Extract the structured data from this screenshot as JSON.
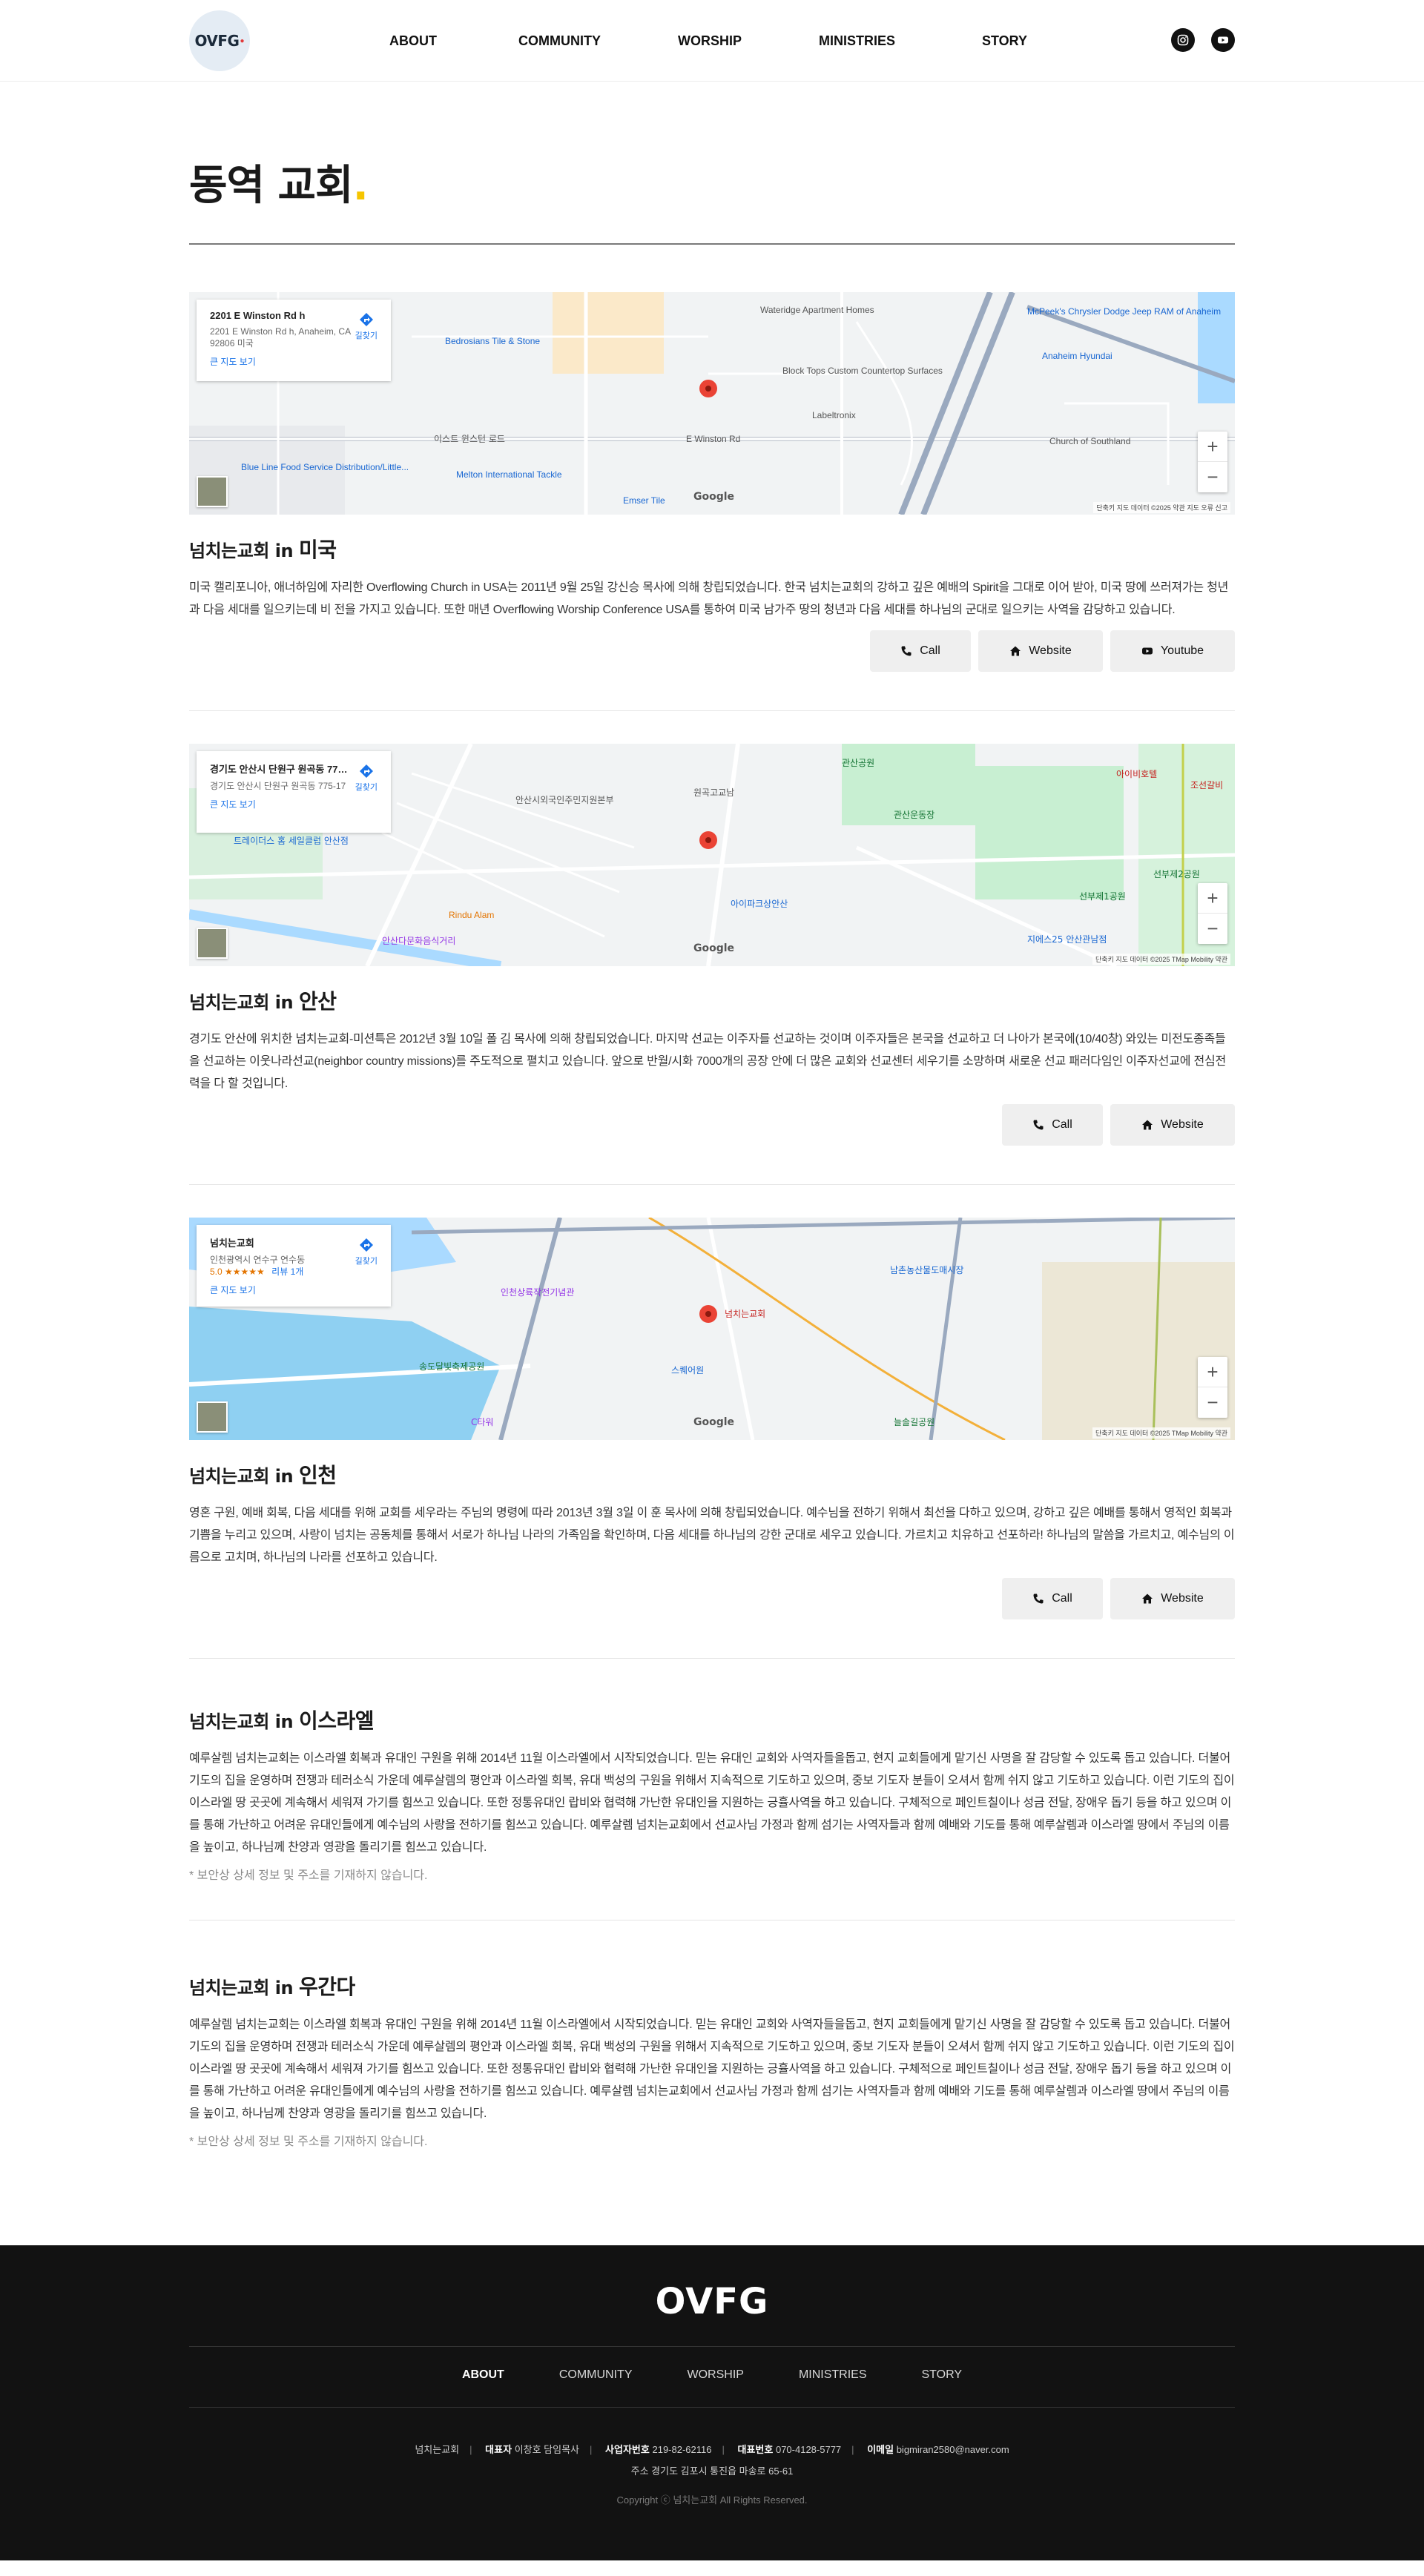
{
  "header": {
    "logo_text": "OVFG",
    "nav": [
      "ABOUT",
      "COMMUNITY",
      "WORSHIP",
      "MINISTRIES",
      "STORY"
    ],
    "social": [
      "instagram-icon",
      "youtube-icon"
    ]
  },
  "page": {
    "title": "동역 교회",
    "title_dot": "."
  },
  "churches": [
    {
      "prefix": "넘치는교회 in",
      "location": "미국",
      "map": {
        "place": "2201 E Winston Rd h",
        "address": "2201 E Winston Rd h, Anaheim, CA 92806 미국",
        "larger_map": "큰 지도 보기",
        "directions": "길찾기",
        "google": "Google",
        "attribution": "단축키   지도 데이터 ©2025   약관   지도 오류 신고",
        "labels": [
          "Wateridge Apartment Homes",
          "Bedrosians Tile & Stone",
          "Block Tops Custom Countertop Surfaces",
          "Labeltronix",
          "McPeek's Chrysler Dodge Jeep RAM of Anaheim",
          "Anaheim Hyundai",
          "Church of Southland",
          "이스트 윈스턴 로드",
          "E Winston Rd",
          "Blue Line Food Service Distribution/Little...",
          "Melton International Tackle",
          "Emser Tile"
        ]
      },
      "description": "미국 캘리포니아, 애너하임에 자리한 Overflowing Church in USA는 2011년 9월 25일 강신승 목사에 의해 창립되었습니다. 한국 넘치는교회의 강하고 깊은 예배의 Spirit을 그대로 이어 받아, 미국 땅에 쓰러져가는 청년과 다음 세대를 일으키는데 비 전을 가지고 있습니다. 또한 매년 Overflowing Worship Conference USA를 통하여 미국 남가주 땅의 청년과 다음 세대를 하나님의 군대로 일으키는 사역을 감당하고 있습니다.",
      "buttons": [
        "Call",
        "Website",
        "Youtube"
      ]
    },
    {
      "prefix": "넘치는교회 in",
      "location": "안산",
      "map": {
        "place": "경기도 안산시 단원구 원곡동 775-17",
        "address": "경기도 안산시 단원구 원곡동 775-17",
        "larger_map": "큰 지도 보기",
        "directions": "길찾기",
        "google": "Google",
        "attribution": "단축키   지도 데이터 ©2025 TMap Mobility   약관",
        "labels": [
          "관산공원",
          "관산운동장",
          "아이비호텔",
          "조선갈비",
          "선부제2공원",
          "선부제1공원",
          "트레이더스 홈 세일클럽 안산점",
          "Rindu Alam",
          "안산다문화음식거리",
          "아이파크상안산",
          "지에스25 안산관남점",
          "원곡고교남",
          "안산시외국인주민지원본부"
        ]
      },
      "description": "경기도 안산에 위치한 넘치는교회-미션특은 2012년 3월 10일 폴 김 목사에 의해 창립되었습니다. 마지막 선교는 이주자를 선교하는 것이며 이주자들은 본국을 선교하고 더 나아가 본국에(10/40창) 와있는 미전도종족들을 선교하는 이웃나라선교(neighbor country missions)를 주도적으로 펼치고 있습니다. 앞으로 반월/시화 7000개의 공장 안에 더 많은 교회와 선교센터 세우기를 소망하며 새로운 선교 패러다임인 이주자선교에 전심전력을 다 할 것입니다.",
      "buttons": [
        "Call",
        "Website"
      ]
    },
    {
      "prefix": "넘치는교회 in",
      "location": "인천",
      "map": {
        "place": "넘치는교회",
        "address": "인천광역시 연수구 연수동",
        "rating": "5.0 ★★★★★",
        "reviews": "리뷰 1개",
        "larger_map": "큰 지도 보기",
        "directions": "길찾기",
        "google": "Google",
        "attribution": "단축키   지도 데이터 ©2025 TMap Mobility   약관",
        "labels": [
          "넘치는교회",
          "인천상륙작전기념관",
          "남촌농산물도매시장",
          "송도달빛축제공원",
          "스퀘어원",
          "늘솔길공원",
          "C타워"
        ]
      },
      "description": "영혼 구원, 예배 회복, 다음 세대를 위해 교회를 세우라는 주님의 명령에 따라 2013년 3월 3일 이 훈 목사에 의해 창립되었습니다.  예수님을 전하기 위해서 최선을 다하고 있으며, 강하고 깊은 예배를 통해서 영적인 회복과 기쁨을 누리고 있으며, 사랑이 넘치는 공동체를 통해서 서로가 하나님 나라의 가족임을 확인하며, 다음 세대를 하나님의 강한 군대로 세우고 있습니다.  가르치고 치유하고 선포하라!  하나님의 말씀을 가르치고, 예수님의 이름으로 고치며, 하나님의 나라를 선포하고 있습니다.",
      "buttons": [
        "Call",
        "Website"
      ]
    }
  ],
  "text_churches": [
    {
      "prefix": "넘치는교회 in",
      "location": "이스라엘",
      "description": "예루살렘 넘치는교회는 이스라엘 회복과 유대인 구원을 위해 2014년 11월 이스라엘에서 시작되었습니다. 믿는 유대인 교회와 사역자들을돕고, 현지 교회들에게 맡기신 사명을 잘 감당할 수 있도록 돕고 있습니다. 더불어 기도의 집을 운영하며 전쟁과 테러소식 가운데 예루살렘의 평안과 이스라엘 회복, 유대 백성의 구원을 위해서 지속적으로 기도하고 있으며, 중보 기도자 분들이 오셔서 함께 쉬지 않고 기도하고 있습니다. 이런 기도의 집이 이스라엘 땅 곳곳에 계속해서 세워져 가기를 힘쓰고 있습니다. 또한 정통유대인 랍비와 협력해 가난한 유대인을 지원하는 긍휼사역을 하고 있습니다. 구체적으로 페인트칠이나 성금 전달, 장애우 돕기 등을 하고 있으며 이를 통해 가난하고 어려운 유대인들에게 예수님의 사랑을 전하기를 힘쓰고 있습니다. 예루살렘 넘치는교회에서 선교사님 가정과 함께 섬기는 사역자들과 함께 예배와 기도를 통해 예루살렘과 이스라엘 땅에서 주님의 이름을 높이고, 하나님께 찬양과 영광을 돌리기를 힘쓰고 있습니다.",
      "note": "* 보안상 상세 정보 및 주소를 기재하지 않습니다."
    },
    {
      "prefix": "넘치는교회 in",
      "location": "우간다",
      "description": "예루살렘 넘치는교회는 이스라엘 회복과 유대인 구원을 위해 2014년 11월 이스라엘에서 시작되었습니다. 믿는 유대인 교회와 사역자들을돕고, 현지 교회들에게 맡기신 사명을 잘 감당할 수 있도록 돕고 있습니다. 더불어 기도의 집을 운영하며 전쟁과 테러소식 가운데 예루살렘의 평안과 이스라엘 회복, 유대 백성의 구원을 위해서 지속적으로 기도하고 있으며, 중보 기도자 분들이 오셔서 함께 쉬지 않고 기도하고 있습니다. 이런 기도의 집이 이스라엘 땅 곳곳에 계속해서 세워져 가기를 힘쓰고 있습니다. 또한 정통유대인 랍비와 협력해 가난한 유대인을 지원하는 긍휼사역을 하고 있습니다. 구체적으로 페인트칠이나 성금 전달, 장애우 돕기 등을 하고 있으며 이를 통해 가난하고 어려운 유대인들에게 예수님의 사랑을 전하기를 힘쓰고 있습니다. 예루살렘 넘치는교회에서 선교사님 가정과 함께 섬기는 사역자들과 함께 예배와 기도를 통해 예루살렘과 이스라엘 땅에서 주님의 이름을 높이고, 하나님께 찬양과 영광을 돌리기를 힘쓰고 있습니다.",
      "note": "* 보안상 상세 정보 및 주소를 기재하지 않습니다."
    }
  ],
  "footer": {
    "logo": "OVFG",
    "nav": [
      "ABOUT",
      "COMMUNITY",
      "WORSHIP",
      "MINISTRIES",
      "STORY"
    ],
    "org": "넘치는교회",
    "rep_label": "대표자",
    "rep": "이창호 담임목사",
    "biz_label": "사업자번호",
    "biz": "219-82-62116",
    "tel_label": "대표번호",
    "tel": "070-4128-5777",
    "email_label": "이메일",
    "email": "bigmiran2580@naver.com",
    "address": "주소 경기도 김포시 통진읍 마송로 65-61",
    "copyright": "Copyright ⓒ 넘치는교회 All Rights Reserved."
  },
  "colors": {
    "accent_dot": "#f6c500",
    "footer_bg": "#121212",
    "button_bg": "#efefef",
    "map_pin": "#ea4335",
    "map_link": "#1a73e8"
  }
}
